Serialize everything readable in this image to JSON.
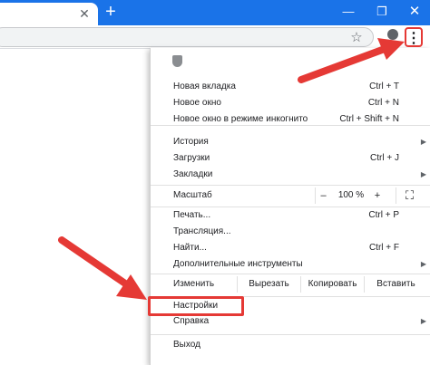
{
  "titlebar": {
    "tab_close": "✕",
    "new_tab": "+",
    "minimize": "—",
    "restore": "❐",
    "close": "✕"
  },
  "toolbar": {
    "bookmark_star": "☆",
    "menu_dots": "⋮"
  },
  "menu": {
    "groups": [
      {
        "id": "new",
        "items": [
          {
            "label": "Новая вкладка",
            "shortcut": "Ctrl + T"
          },
          {
            "label": "Новое окно",
            "shortcut": "Ctrl + N"
          },
          {
            "label": "Новое окно в режиме инкогнито",
            "shortcut": "Ctrl + Shift + N"
          }
        ]
      },
      {
        "id": "history",
        "items": [
          {
            "label": "История",
            "shortcut": "",
            "submenu": true
          },
          {
            "label": "Загрузки",
            "shortcut": "Ctrl + J"
          },
          {
            "label": "Закладки",
            "shortcut": "",
            "submenu": true
          }
        ]
      }
    ],
    "zoom": {
      "label": "Масштаб",
      "minus": "–",
      "value": "100 %",
      "plus": "+",
      "fullscreen": "⛶"
    },
    "tools": [
      {
        "label": "Печать...",
        "shortcut": "Ctrl + P"
      },
      {
        "label": "Трансляция...",
        "shortcut": ""
      },
      {
        "label": "Найти...",
        "shortcut": "Ctrl + F"
      },
      {
        "label": "Дополнительные инструменты",
        "shortcut": "",
        "submenu": true
      }
    ],
    "edit": {
      "label": "Изменить",
      "cut": "Вырезать",
      "copy": "Копировать",
      "paste": "Вставить"
    },
    "settings": "Настройки",
    "help": "Справка",
    "exit": "Выход",
    "submenu_arrow": "▶"
  },
  "colors": {
    "accent": "#1a73e8",
    "annotation": "#e53935"
  }
}
